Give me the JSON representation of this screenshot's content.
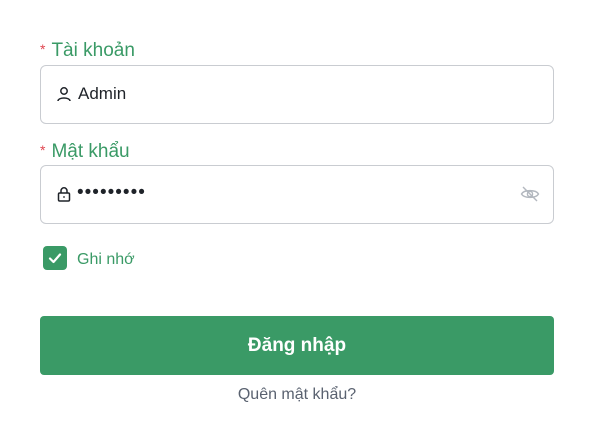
{
  "form": {
    "username": {
      "required_mark": "*",
      "label": "Tài khoản",
      "value": "Admin",
      "icon": "user-icon"
    },
    "password": {
      "required_mark": "*",
      "label": "Mật khẩu",
      "masked_value": "•••••••••",
      "icon": "lock-icon",
      "toggle_icon": "eye-off-icon"
    },
    "remember": {
      "label": "Ghi nhớ",
      "checked": true
    },
    "submit_label": "Đăng nhập",
    "forgot_label": "Quên mật khẩu?"
  },
  "colors": {
    "primary": "#3a9a66",
    "required": "#e0454f",
    "border": "#c9ccd1",
    "text": "#1f2329",
    "muted": "#5a6270"
  }
}
